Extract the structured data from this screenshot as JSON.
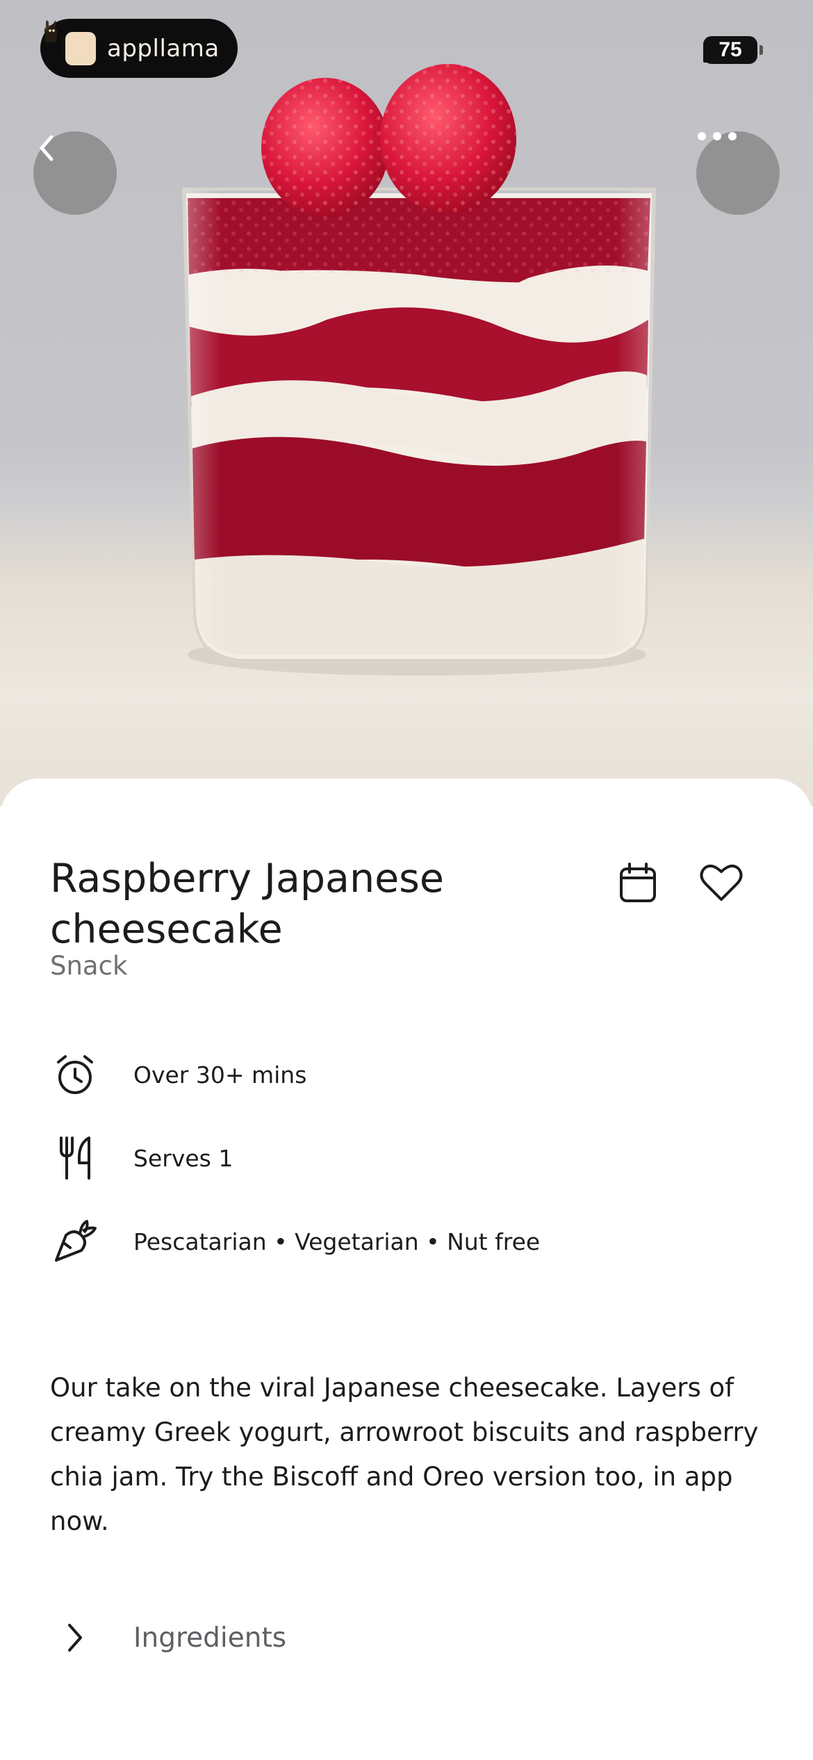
{
  "status_bar": {
    "brand_name": "appllama",
    "battery_level": "75"
  },
  "hero": {
    "image": "raspberry-cheesecake-glass-photo",
    "back_icon": "chevron-left-icon",
    "more_icon": "ellipsis-icon"
  },
  "recipe": {
    "title": "Raspberry Japanese cheesecake",
    "category": "Snack",
    "meta": [
      {
        "icon": "alarm-clock-icon",
        "text": "Over 30+ mins"
      },
      {
        "icon": "fork-knife-icon",
        "text": "Serves 1"
      },
      {
        "icon": "carrot-icon",
        "text": "Pescatarian • Vegetarian • Nut free"
      }
    ],
    "description": "Our take on the viral Japanese cheesecake. Layers of creamy Greek yogurt, arrowroot biscuits and raspberry chia jam. Try the Biscoff and Oreo version too, in app now.",
    "sections": [
      {
        "label": "Ingredients",
        "icon": "chevron-right-icon"
      }
    ]
  },
  "colors": {
    "raspberry": "#a0102c",
    "cream": "#f1ece4",
    "text": "#1c1c1c",
    "muted": "#6e6e73"
  }
}
